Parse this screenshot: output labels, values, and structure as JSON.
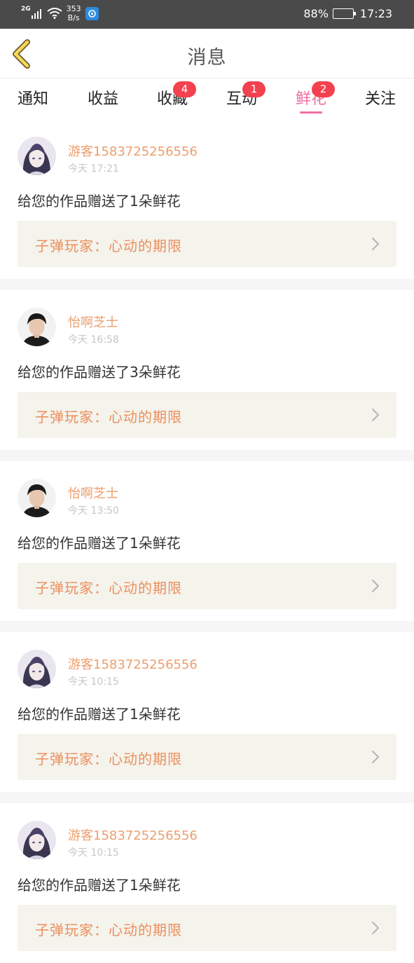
{
  "status_bar": {
    "network": "2G",
    "speed_value": "353",
    "speed_unit": "B/s",
    "battery": "88%",
    "battery_level": 0.88,
    "time": "17:23"
  },
  "header": {
    "title": "消息",
    "back_icon": "chevron-left-icon"
  },
  "tabs": [
    {
      "label": "通知",
      "badge": ""
    },
    {
      "label": "收益",
      "badge": ""
    },
    {
      "label": "收藏",
      "badge": "4"
    },
    {
      "label": "互动",
      "badge": "1"
    },
    {
      "label": "鲜花",
      "badge": "2",
      "active": true
    },
    {
      "label": "关注",
      "badge": ""
    }
  ],
  "colors": {
    "accent": "#ee6fa2",
    "username": "#ed9e6c",
    "badge": "#f4414f",
    "work_card": "#f4f3ec"
  },
  "messages": [
    {
      "user": "游客1583725256556",
      "time": "今天 17:21",
      "text": "给您的作品赠送了1朵鲜花",
      "work": "子弹玩家：心动的期限",
      "avatar": "anime-avatar"
    },
    {
      "user": "怡啊芝士",
      "time": "今天 16:58",
      "text": "给您的作品赠送了3朵鲜花",
      "work": "子弹玩家：心动的期限",
      "avatar": "photo-avatar"
    },
    {
      "user": "怡啊芝士",
      "time": "今天 13:50",
      "text": "给您的作品赠送了1朵鲜花",
      "work": "子弹玩家：心动的期限",
      "avatar": "photo-avatar"
    },
    {
      "user": "游客1583725256556",
      "time": "今天 10:15",
      "text": "给您的作品赠送了1朵鲜花",
      "work": "子弹玩家：心动的期限",
      "avatar": "anime-avatar"
    },
    {
      "user": "游客1583725256556",
      "time": "今天 10:15",
      "text": "给您的作品赠送了1朵鲜花",
      "work": "子弹玩家：心动的期限",
      "avatar": "anime-avatar"
    }
  ]
}
